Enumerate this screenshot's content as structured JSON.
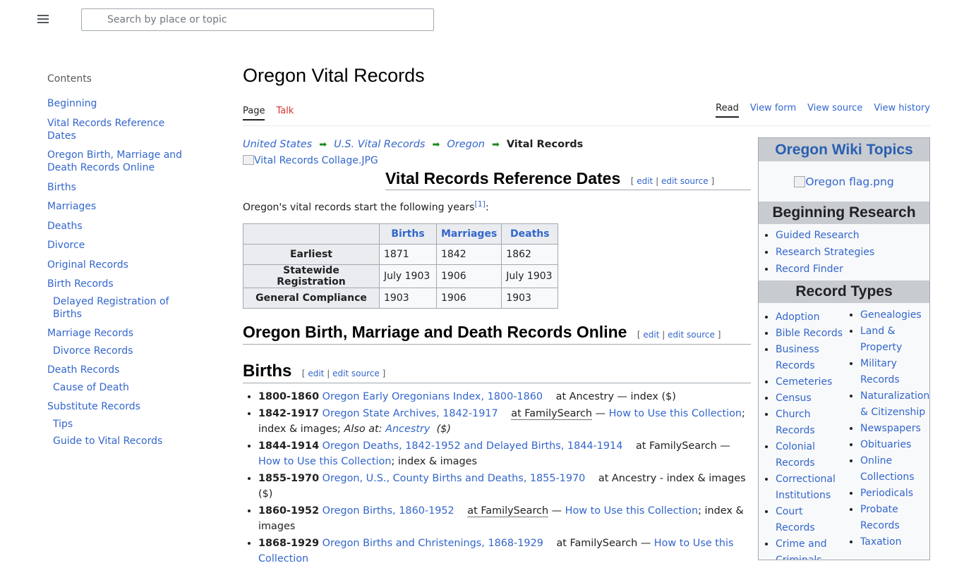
{
  "header": {
    "search_placeholder": "Search by place or topic"
  },
  "toc": {
    "title": "Contents",
    "items": [
      {
        "label": "Beginning"
      },
      {
        "label": "Vital Records Reference Dates"
      },
      {
        "label": "Oregon Birth, Marriage and Death Records Online"
      },
      {
        "label": "Births"
      },
      {
        "label": "Marriages"
      },
      {
        "label": "Deaths"
      },
      {
        "label": "Divorce"
      },
      {
        "label": "Original Records"
      },
      {
        "label": "Birth Records"
      },
      {
        "label": "Delayed Registration of Births"
      },
      {
        "label": "Marriage Records"
      },
      {
        "label": "Divorce Records"
      },
      {
        "label": "Death Records"
      },
      {
        "label": "Cause of Death"
      },
      {
        "label": "Substitute Records"
      },
      {
        "label": "Tips"
      },
      {
        "label": "Guide to Vital Records"
      }
    ]
  },
  "page": {
    "title": "Oregon Vital Records",
    "tabs_left": [
      "Page",
      "Talk"
    ],
    "tabs_right": [
      "Read",
      "View form",
      "View source",
      "View history"
    ]
  },
  "breadcrumb": {
    "items": [
      "United States",
      "U.S. Vital Records",
      "Oregon"
    ],
    "current": "Vital Records",
    "arrow": "➡"
  },
  "collage_alt": "Vital Records Collage.JPG",
  "edit_links": {
    "edit": "edit",
    "edit_source": "edit source",
    "open": "[",
    "sep": "|",
    "close": "]"
  },
  "ref_dates": {
    "heading": "Vital Records Reference Dates",
    "intro": "Oregon's vital records start the following years",
    "footnote": "[1]",
    "intro_end": ":",
    "columns": [
      "Births",
      "Marriages",
      "Deaths"
    ],
    "rows": [
      {
        "label": "Earliest",
        "values": [
          "1871",
          "1842",
          "1862"
        ]
      },
      {
        "label": "Statewide Registration",
        "values": [
          "July 1903",
          "1906",
          "July 1903"
        ]
      },
      {
        "label": "General Compliance",
        "values": [
          "1903",
          "1906",
          "1903"
        ]
      }
    ]
  },
  "online_heading": "Oregon Birth, Marriage and Death Records Online",
  "births": {
    "heading": "Births",
    "items": [
      {
        "years": "1800-1860",
        "link": "Oregon Early Oregonians Index, 1800-1860",
        "text": "at Ancestry — index ($)"
      },
      {
        "years": "1842-1917",
        "link": "Oregon State Archives, 1842-1917",
        "site": "at FamilySearch",
        "dash": " — ",
        "howto": "How to Use this Collection",
        "text": "; index & images; ",
        "also": "Also at:",
        "also_link": "Ancestry",
        "paid": "($)"
      },
      {
        "years": "1844-1914",
        "link": "Oregon Deaths, 1842-1952 and Delayed Births, 1844-1914",
        "site": "at FamilySearch",
        "dash": " — ",
        "howto": "How to Use this Collection",
        "text": "; index & images"
      },
      {
        "years": "1855-1970",
        "link": "Oregon, U.S., County Births and Deaths, 1855-1970",
        "text": "at Ancestry - index & images ($)"
      },
      {
        "years": "1860-1952",
        "link": "Oregon Births, 1860-1952",
        "site": "at FamilySearch",
        "dash": " — ",
        "howto": "How to Use this Collection",
        "text": "; index & images"
      },
      {
        "years": "1868-1929",
        "link": "Oregon Births and Christenings, 1868-1929",
        "site": "at FamilySearch",
        "dash": " — ",
        "howto": "How to Use this Collection",
        "text": ""
      }
    ]
  },
  "infobox": {
    "title": "Oregon Wiki Topics",
    "flag_alt": "Oregon flag.png",
    "beginning_heading": "Beginning Research",
    "beginning_items": [
      "Guided Research",
      "Research Strategies",
      "Record Finder"
    ],
    "record_types_heading": "Record Types",
    "record_types_left": [
      "Adoption",
      "Bible Records",
      "Business Records",
      "Cemeteries",
      "Census",
      "Church Records",
      "Colonial Records",
      "Correctional Institutions",
      "Court Records",
      "Crime and Criminals"
    ],
    "record_types_right": [
      "Genealogies",
      "Land & Property",
      "Military Records",
      "Naturalization & Citizenship",
      "Newspapers",
      "Obituaries",
      "Online Collections",
      "Periodicals",
      "Probate Records",
      "Taxation"
    ]
  },
  "colors": {
    "link": "#3366cc",
    "talk_red": "#d73333",
    "arrow_green": "#1f8b1f",
    "band_gray": "#c8ccd1",
    "infobox_title": "#2a5fb0"
  }
}
